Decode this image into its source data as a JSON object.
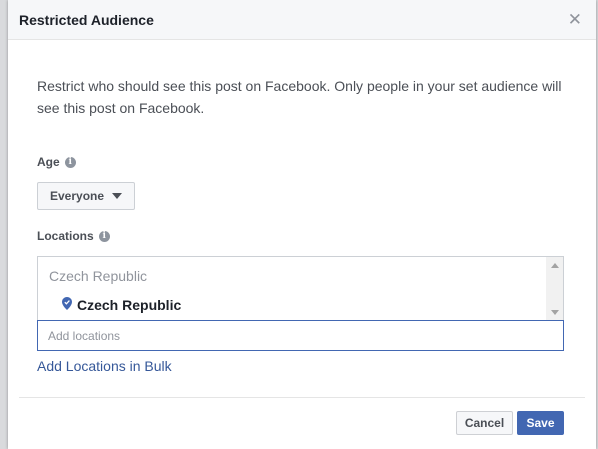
{
  "dialog": {
    "title": "Restricted Audience",
    "close_icon": "close-icon",
    "description": "Restrict who should see this post on Facebook. Only people in your set audience will see this post on Facebook."
  },
  "age": {
    "label": "Age",
    "info_icon": "info-icon",
    "selected": "Everyone"
  },
  "locations": {
    "label": "Locations",
    "info_icon": "info-icon",
    "group_header": "Czech Republic",
    "selected_items": [
      {
        "name": "Czech Republic",
        "icon": "location-pin-icon"
      }
    ],
    "input_placeholder": "Add locations",
    "input_value": "",
    "bulk_link": "Add Locations in Bulk"
  },
  "footer": {
    "cancel_label": "Cancel",
    "save_label": "Save"
  },
  "colors": {
    "accent": "#4267b2",
    "link": "#365899",
    "pin": "#4267b2"
  }
}
